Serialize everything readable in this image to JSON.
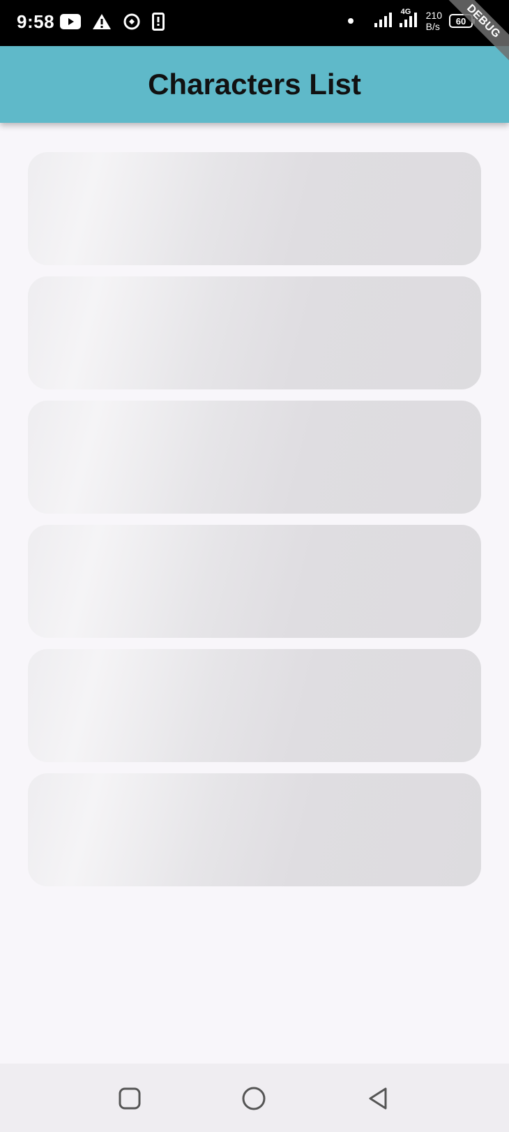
{
  "status_bar": {
    "time": "9:58",
    "net_speed_value": "210",
    "net_speed_unit": "B/s",
    "network_type": "4G",
    "battery": "60"
  },
  "debug_banner": "DEBUG",
  "app_bar": {
    "title": "Characters List",
    "color": "#5fb9c9"
  },
  "skeleton_cards": [
    {
      "state": "loading"
    },
    {
      "state": "loading"
    },
    {
      "state": "loading"
    },
    {
      "state": "loading"
    },
    {
      "state": "loading"
    },
    {
      "state": "loading"
    }
  ],
  "nav_bar": {
    "buttons": [
      "recents-icon",
      "home-icon",
      "back-icon"
    ]
  }
}
